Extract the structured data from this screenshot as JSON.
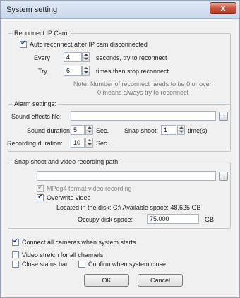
{
  "window": {
    "title": "System setting",
    "close_glyph": "x"
  },
  "reconnect": {
    "legend": "Reconnect IP Cam:",
    "auto_label": "Auto reconnect after IP cam disconnected",
    "auto_checked": true,
    "every_label": "Every",
    "every_value": "4",
    "every_suffix": "seconds, try to reconnect",
    "try_label": "Try",
    "try_value": "6",
    "try_suffix": "times then stop reconnect",
    "note_line1": "Note: Number of reconnect needs to be 0 or over",
    "note_line2": "0 means always try to reconnect"
  },
  "alarm": {
    "legend": "Alarm settings:",
    "sound_file_label": "Sound effects file:",
    "sound_file_value": "",
    "sound_duration_label": "Sound duration:",
    "sound_duration_value": "5",
    "sec_label": "Sec.",
    "snapshot_label": "Snap shoot:",
    "snapshot_value": "1",
    "times_label": "time(s)",
    "recording_duration_label": "Recording duration:",
    "recording_duration_value": "10",
    "recording_sec_label": "Sec."
  },
  "path": {
    "legend": "Snap shoot and video recording path:",
    "path_value": "",
    "browse_label": "...",
    "mpeg4_label": "MPeg4 format video recording",
    "mpeg4_checked": true,
    "mpeg4_enabled": false,
    "overwrite_label": "Overwrite video",
    "overwrite_checked": true,
    "disk_info": "Located in the disk: C:\\  Available space: 48,625 GB",
    "occupy_label": "Occupy disk space:",
    "occupy_value": "75.000",
    "occupy_unit": "GB"
  },
  "options": {
    "connect_all_label": "Connect all cameras when system starts",
    "connect_all_checked": true,
    "video_stretch_label": "Video stretch for all channels",
    "video_stretch_checked": false,
    "close_status_label": "Close status bar",
    "close_status_checked": false,
    "confirm_close_label": "Confirm when system close",
    "confirm_close_checked": false
  },
  "buttons": {
    "ok": "OK",
    "cancel": "Cancel"
  }
}
